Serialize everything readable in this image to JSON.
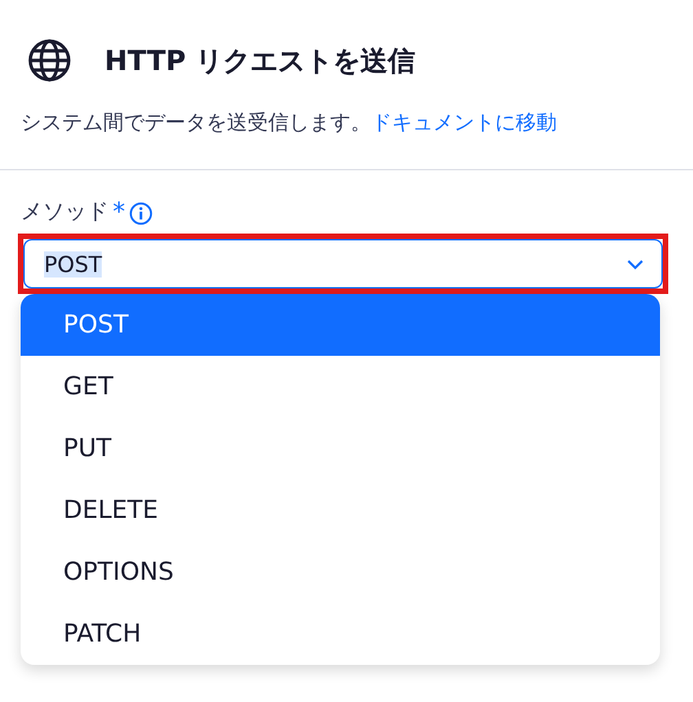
{
  "header": {
    "title": "HTTP リクエストを送信",
    "description": "システム間でデータを送受信します。",
    "link": "ドキュメントに移動"
  },
  "method_field": {
    "label": "メソッド",
    "required_mark": "*",
    "value": "POST",
    "highlighted": true,
    "expanded": true
  },
  "options": [
    {
      "label": "POST",
      "selected": true
    },
    {
      "label": "GET",
      "selected": false
    },
    {
      "label": "PUT",
      "selected": false
    },
    {
      "label": "DELETE",
      "selected": false
    },
    {
      "label": "OPTIONS",
      "selected": false
    },
    {
      "label": "PATCH",
      "selected": false
    }
  ]
}
